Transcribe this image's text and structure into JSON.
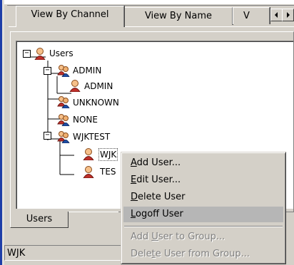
{
  "tabs": [
    {
      "label": "View By Channel",
      "active": true
    },
    {
      "label": "View By Name",
      "active": false
    },
    {
      "label": "V",
      "active": false
    }
  ],
  "tab_scroll": {
    "left_icon": "arrow-left-icon",
    "right_icon": "arrow-right-icon"
  },
  "tree": {
    "root": {
      "label": "Users",
      "icon": "user-icon",
      "expander": "−"
    },
    "admin_group": {
      "label": "ADMIN",
      "icon": "group-icon",
      "expander": "−"
    },
    "admin_user": {
      "label": "ADMIN",
      "icon": "user-icon"
    },
    "unknown_group": {
      "label": "UNKNOWN",
      "icon": "group-icon"
    },
    "none_group": {
      "label": "NONE",
      "icon": "group-icon"
    },
    "wjktest_group": {
      "label": "WJKTEST",
      "icon": "group-icon",
      "expander": "−"
    },
    "wjk_user": {
      "label": "WJK",
      "icon": "user-icon",
      "selected": true
    },
    "test_user": {
      "label": "TES",
      "icon": "user-icon"
    }
  },
  "bottom_tab": {
    "label": "Users"
  },
  "status": {
    "text": "WJK"
  },
  "context_menu": {
    "items": [
      {
        "pre": "",
        "key": "A",
        "post": "dd User...",
        "enabled": true
      },
      {
        "pre": "",
        "key": "E",
        "post": "dit User...",
        "enabled": true
      },
      {
        "pre": "",
        "key": "D",
        "post": "elete User",
        "enabled": true
      },
      {
        "pre": "",
        "key": "L",
        "post": "ogoff User",
        "enabled": true,
        "highlighted": true
      },
      {
        "pre": "Add ",
        "key": "U",
        "post": "ser to Group...",
        "enabled": false
      },
      {
        "pre": "Dele",
        "key": "t",
        "post": "e User from Group...",
        "enabled": false
      }
    ]
  },
  "colors": {
    "face": "#d4d0c8",
    "window_border_blue": "#1e3ea8",
    "menu_highlight": "#b6b6b6",
    "disabled_text": "#808080"
  }
}
